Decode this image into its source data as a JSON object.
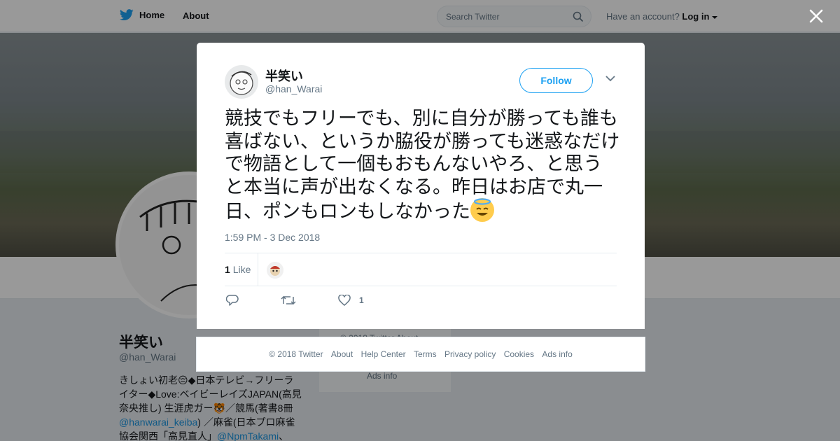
{
  "nav": {
    "home_label": "Home",
    "about_label": "About",
    "search_placeholder": "Search Twitter",
    "account_prompt": "Have an account?",
    "login_label": "Log in"
  },
  "profile": {
    "name": "半笑い",
    "handle": "@han_Warai",
    "bio_parts": [
      "きしょい初老",
      "◆日本テレビ→フリーライター◆Love:ベイビーレイズJAPAN(高見奈央推し) 生涯虎ガー",
      "／競馬(著書8冊",
      "@hanwarai_keiba",
      ") ／麻雀(日本プロ麻雀協会関西「高見直人」",
      "@NpmTakami",
      "、"
    ],
    "side_text_1": "© 2018 Twitter  About",
    "side_text_2": "Ads info"
  },
  "tweet": {
    "author_name": "半笑い",
    "author_handle": "@han_Warai",
    "follow_label": "Follow",
    "text": "競技でもフリーでも、別に自分が勝っても誰も喜ばない、というか脇役が勝っても迷惑なだけで物語として一個もおもんないやろ、と思うと本当に声が出なくなる。昨日はお店で丸一日、ポンもロンもしなかった",
    "emoji_icon": "smiling-face-with-halo",
    "timestamp": "1:59 PM - 3 Dec 2018",
    "like_count": "1",
    "like_label": "Like",
    "action_like_count": "1"
  },
  "footer": {
    "copyright": "© 2018 Twitter",
    "links": [
      "About",
      "Help Center",
      "Terms",
      "Privacy policy",
      "Cookies",
      "Ads info"
    ]
  },
  "colors": {
    "brand_blue": "#1da1f2",
    "overlay": "rgba(0,0,0,0.4)",
    "halo_emoji_yellow": "#ffcc4d"
  }
}
